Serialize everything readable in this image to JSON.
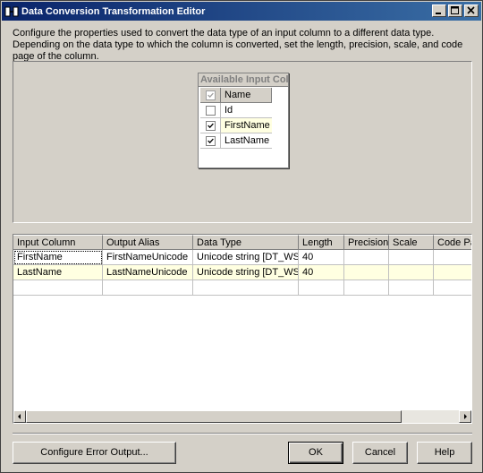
{
  "window": {
    "title": "Data Conversion Transformation Editor"
  },
  "description": "Configure the properties used to convert the data type of an input column to a different data type. Depending on the data type to which the column is converted, set the length, precision, scale, and code page of the column.",
  "available_columns": {
    "title": "Available Input Col...",
    "header": "Name",
    "rows": [
      {
        "name": "Id",
        "checked": false
      },
      {
        "name": "FirstName",
        "checked": true
      },
      {
        "name": "LastName",
        "checked": true
      }
    ]
  },
  "grid": {
    "columns": [
      "Input Column",
      "Output Alias",
      "Data Type",
      "Length",
      "Precision",
      "Scale",
      "Code Page"
    ],
    "rows": [
      [
        "FirstName",
        "FirstNameUnicode",
        "Unicode string [DT_WSTR]",
        "40",
        "",
        "",
        ""
      ],
      [
        "LastName",
        "LastNameUnicode",
        "Unicode string [DT_WSTR]",
        "40",
        "",
        "",
        ""
      ]
    ]
  },
  "buttons": {
    "configure_error_output": "Configure Error Output...",
    "ok": "OK",
    "cancel": "Cancel",
    "help": "Help"
  },
  "colors": {
    "titlebar_start": "#0a246a",
    "titlebar_end": "#3a6ea5",
    "alt_row": "#ffffe1",
    "face": "#d4d0c8"
  }
}
